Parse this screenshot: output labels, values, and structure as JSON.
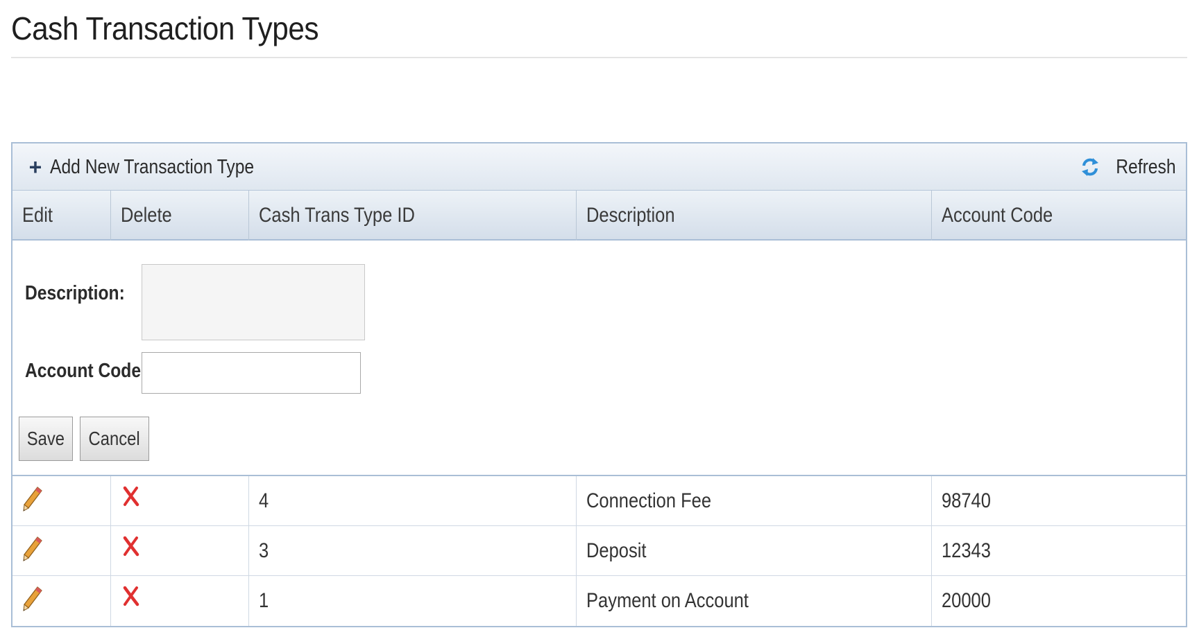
{
  "page": {
    "title": "Cash Transaction Types"
  },
  "toolbar": {
    "add_label": "Add New Transaction Type",
    "refresh_label": "Refresh",
    "add_icon": "plus-icon",
    "refresh_icon": "refresh-icon"
  },
  "columns": {
    "edit": "Edit",
    "delete": "Delete",
    "id": "Cash Trans Type ID",
    "description": "Description",
    "account_code": "Account Code"
  },
  "form": {
    "description_label": "Description:",
    "description_value": "",
    "account_code_label": "Account Code:",
    "account_code_value": "",
    "save_label": "Save",
    "cancel_label": "Cancel"
  },
  "rows": [
    {
      "id": "4",
      "description": "Connection Fee",
      "account_code": "98740"
    },
    {
      "id": "3",
      "description": "Deposit",
      "account_code": "12343"
    },
    {
      "id": "1",
      "description": "Payment on Account",
      "account_code": "20000"
    }
  ],
  "icons": {
    "edit": "pencil-icon",
    "delete": "delete-x-icon"
  },
  "colors": {
    "header_gradient_top": "#edf2f7",
    "header_gradient_bottom": "#d4deea",
    "grid_border": "#a9bed6",
    "delete_icon": "#e03030",
    "refresh_icon": "#2f8fd8"
  }
}
